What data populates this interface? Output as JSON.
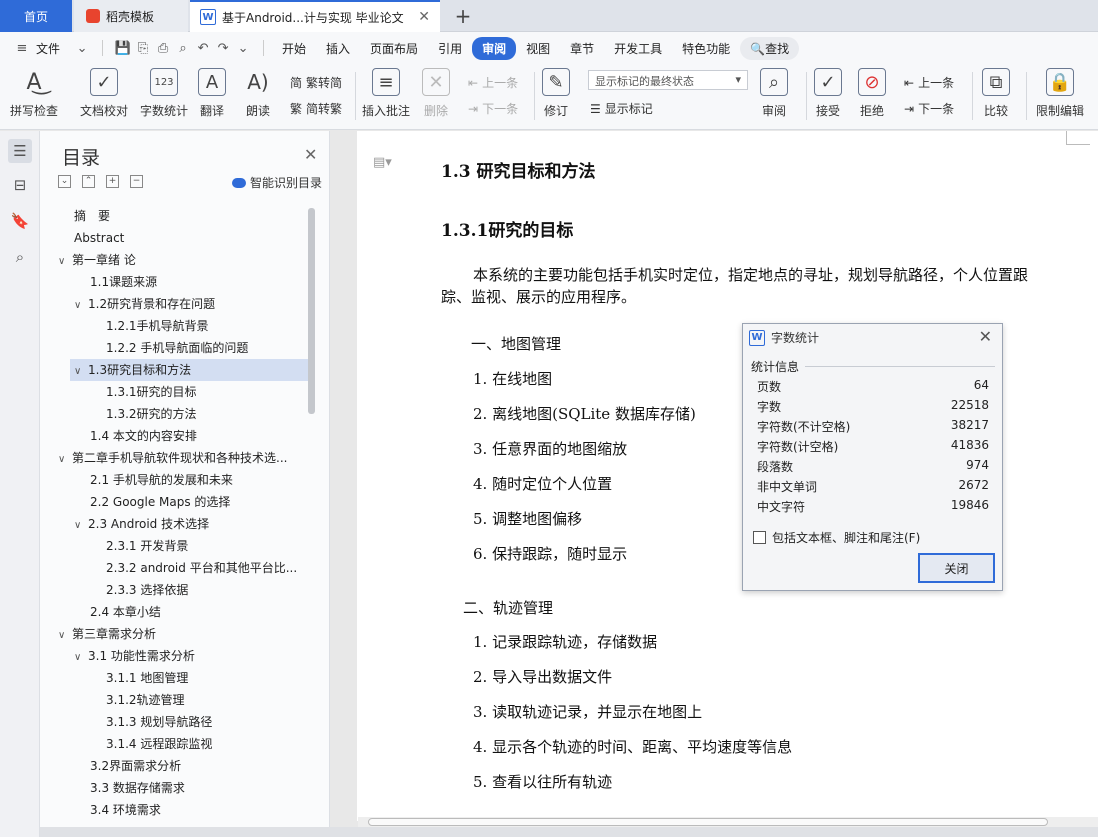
{
  "tabs": {
    "home": "首页",
    "template": "稻壳模板",
    "doc": "基于Android...计与实现 毕业论文",
    "close": "✕",
    "new": "+"
  },
  "menu": {
    "file": "文件",
    "items": [
      "开始",
      "插入",
      "页面布局",
      "引用",
      "审阅",
      "视图",
      "章节",
      "开发工具",
      "特色功能"
    ],
    "active": "审阅",
    "search": "查找"
  },
  "ribbon": {
    "spell": "拼写检查",
    "proofread": "文档校对",
    "wordcount": "字数统计",
    "translate": "翻译",
    "read": "朗读",
    "to_traditional": "繁转简",
    "to_simplified": "简转繁",
    "insert_comment": "插入批注",
    "delete": "删除",
    "prev_comment": "上一条",
    "next_comment": "下一条",
    "revise": "修订",
    "markup_state": "显示标记的最终状态",
    "show_markup": "显示标记",
    "review": "审阅",
    "accept": "接受",
    "reject": "拒绝",
    "prev_change": "上一条",
    "next_change": "下一条",
    "compare": "比较",
    "restrict": "限制编辑"
  },
  "toc": {
    "title": "目录",
    "close": "✕",
    "smart": "智能识别目录",
    "items": [
      {
        "text": "摘　要",
        "level": 0,
        "arrow": ""
      },
      {
        "text": "Abstract",
        "level": 0,
        "arrow": ""
      },
      {
        "text": "第一章绪  论",
        "level": 0,
        "arrow": "∨"
      },
      {
        "text": "1.1课题来源",
        "level": 1,
        "arrow": ""
      },
      {
        "text": "1.2研究背景和存在问题",
        "level": 1,
        "arrow": "∨"
      },
      {
        "text": "1.2.1手机导航背景",
        "level": 2,
        "arrow": ""
      },
      {
        "text": "1.2.2  手机导航面临的问题",
        "level": 2,
        "arrow": ""
      },
      {
        "text": "1.3研究目标和方法",
        "level": 1,
        "arrow": "∨",
        "selected": true
      },
      {
        "text": "1.3.1研究的目标",
        "level": 2,
        "arrow": ""
      },
      {
        "text": "1.3.2研究的方法",
        "level": 2,
        "arrow": ""
      },
      {
        "text": "1.4  本文的内容安排",
        "level": 1,
        "arrow": ""
      },
      {
        "text": "第二章手机导航软件现状和各种技术选...",
        "level": 0,
        "arrow": "∨"
      },
      {
        "text": "2.1 手机导航的发展和未来",
        "level": 1,
        "arrow": ""
      },
      {
        "text": "2.2 Google Maps 的选择",
        "level": 1,
        "arrow": ""
      },
      {
        "text": "2.3 Android  技术选择",
        "level": 1,
        "arrow": "∨"
      },
      {
        "text": "2.3.1 开发背景",
        "level": 2,
        "arrow": ""
      },
      {
        "text": "2.3.2 android 平台和其他平台比...",
        "level": 2,
        "arrow": ""
      },
      {
        "text": "2.3.3  选择依据",
        "level": 2,
        "arrow": ""
      },
      {
        "text": "2.4  本章小结",
        "level": 1,
        "arrow": ""
      },
      {
        "text": "第三章需求分析",
        "level": 0,
        "arrow": "∨"
      },
      {
        "text": "3.1  功能性需求分析",
        "level": 1,
        "arrow": "∨"
      },
      {
        "text": "3.1.1  地图管理",
        "level": 2,
        "arrow": ""
      },
      {
        "text": "3.1.2轨迹管理",
        "level": 2,
        "arrow": ""
      },
      {
        "text": "3.1.3 规划导航路径",
        "level": 2,
        "arrow": ""
      },
      {
        "text": "3.1.4 远程跟踪监视",
        "level": 2,
        "arrow": ""
      },
      {
        "text": "3.2界面需求分析",
        "level": 1,
        "arrow": ""
      },
      {
        "text": "3.3 数据存储需求",
        "level": 1,
        "arrow": ""
      },
      {
        "text": "3.4  环境需求",
        "level": 1,
        "arrow": ""
      }
    ]
  },
  "doc": {
    "h_1_3": "1.3  研究目标和方法",
    "h_1_3_1": "1.3.1研究的目标",
    "intro_line1": "本系统的主要功能包括手机实时定位，指定地点的寻址，规划导航路径，个人位置跟",
    "intro_line2": "踪、监视、展示的应用程序。",
    "sec1": "一、地图管理",
    "sec1_items": [
      "在线地图",
      "离线地图(SQLite 数据库存储)",
      "任意界面的地图缩放",
      "随时定位个人位置",
      "调整地图偏移",
      "保持跟踪，随时显示"
    ],
    "sec2": "二、轨迹管理",
    "sec2_items": [
      "记录跟踪轨迹，存储数据",
      "导入导出数据文件",
      "读取轨迹记录，并显示在地图上",
      "显示各个轨迹的时间、距离、平均速度等信息",
      "查看以往所有轨迹"
    ]
  },
  "dialog": {
    "title": "字数统计",
    "section": "统计信息",
    "stats": [
      {
        "label": "页数",
        "value": "64"
      },
      {
        "label": "字数",
        "value": "22518"
      },
      {
        "label": "字符数(不计空格)",
        "value": "38217"
      },
      {
        "label": "字符数(计空格)",
        "value": "41836"
      },
      {
        "label": "段落数",
        "value": "974"
      },
      {
        "label": "非中文单词",
        "value": "2672"
      },
      {
        "label": "中文字符",
        "value": "19846"
      }
    ],
    "checkbox": "包括文本框、脚注和尾注(F)",
    "close_btn": "关闭"
  }
}
